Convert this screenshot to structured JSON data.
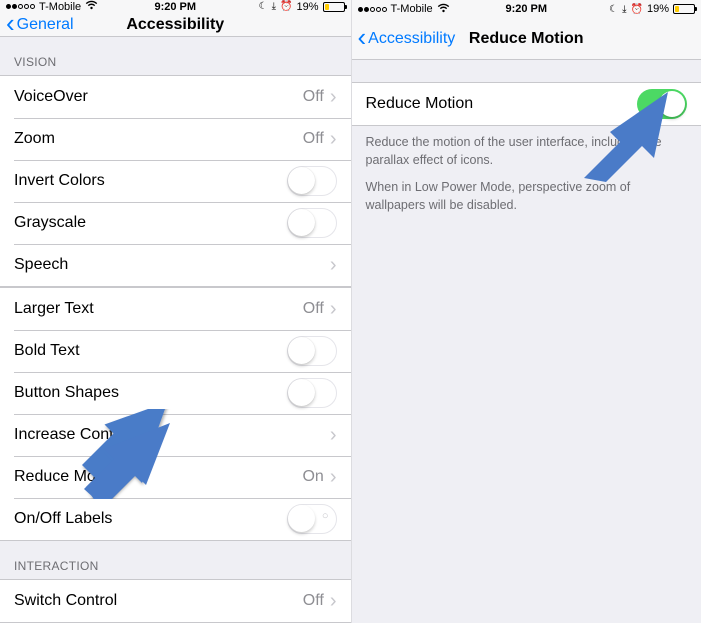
{
  "status": {
    "carrier": "T-Mobile",
    "time": "9:20 PM",
    "battery_percent": "19%"
  },
  "left": {
    "nav": {
      "back": "General",
      "title": "Accessibility"
    },
    "sections": {
      "vision_header": "VISION",
      "interaction_header": "INTERACTION"
    },
    "rows": {
      "voiceover": {
        "label": "VoiceOver",
        "value": "Off"
      },
      "zoom": {
        "label": "Zoom",
        "value": "Off"
      },
      "invert": {
        "label": "Invert Colors"
      },
      "grayscale": {
        "label": "Grayscale"
      },
      "speech": {
        "label": "Speech"
      },
      "larger": {
        "label": "Larger Text",
        "value": "Off"
      },
      "bold": {
        "label": "Bold Text"
      },
      "shapes": {
        "label": "Button Shapes"
      },
      "contrast": {
        "label": "Increase Contrast"
      },
      "reduce": {
        "label": "Reduce Motion",
        "value": "On"
      },
      "onoff": {
        "label": "On/Off Labels"
      },
      "switchcontrol": {
        "label": "Switch Control",
        "value": "Off"
      }
    }
  },
  "right": {
    "nav": {
      "back": "Accessibility",
      "title": "Reduce Motion"
    },
    "rows": {
      "reduce": {
        "label": "Reduce Motion"
      }
    },
    "footer": {
      "p1": "Reduce the motion of the user interface, including the parallax effect of icons.",
      "p2": "When in Low Power Mode, perspective zoom of wallpapers will be disabled."
    }
  }
}
